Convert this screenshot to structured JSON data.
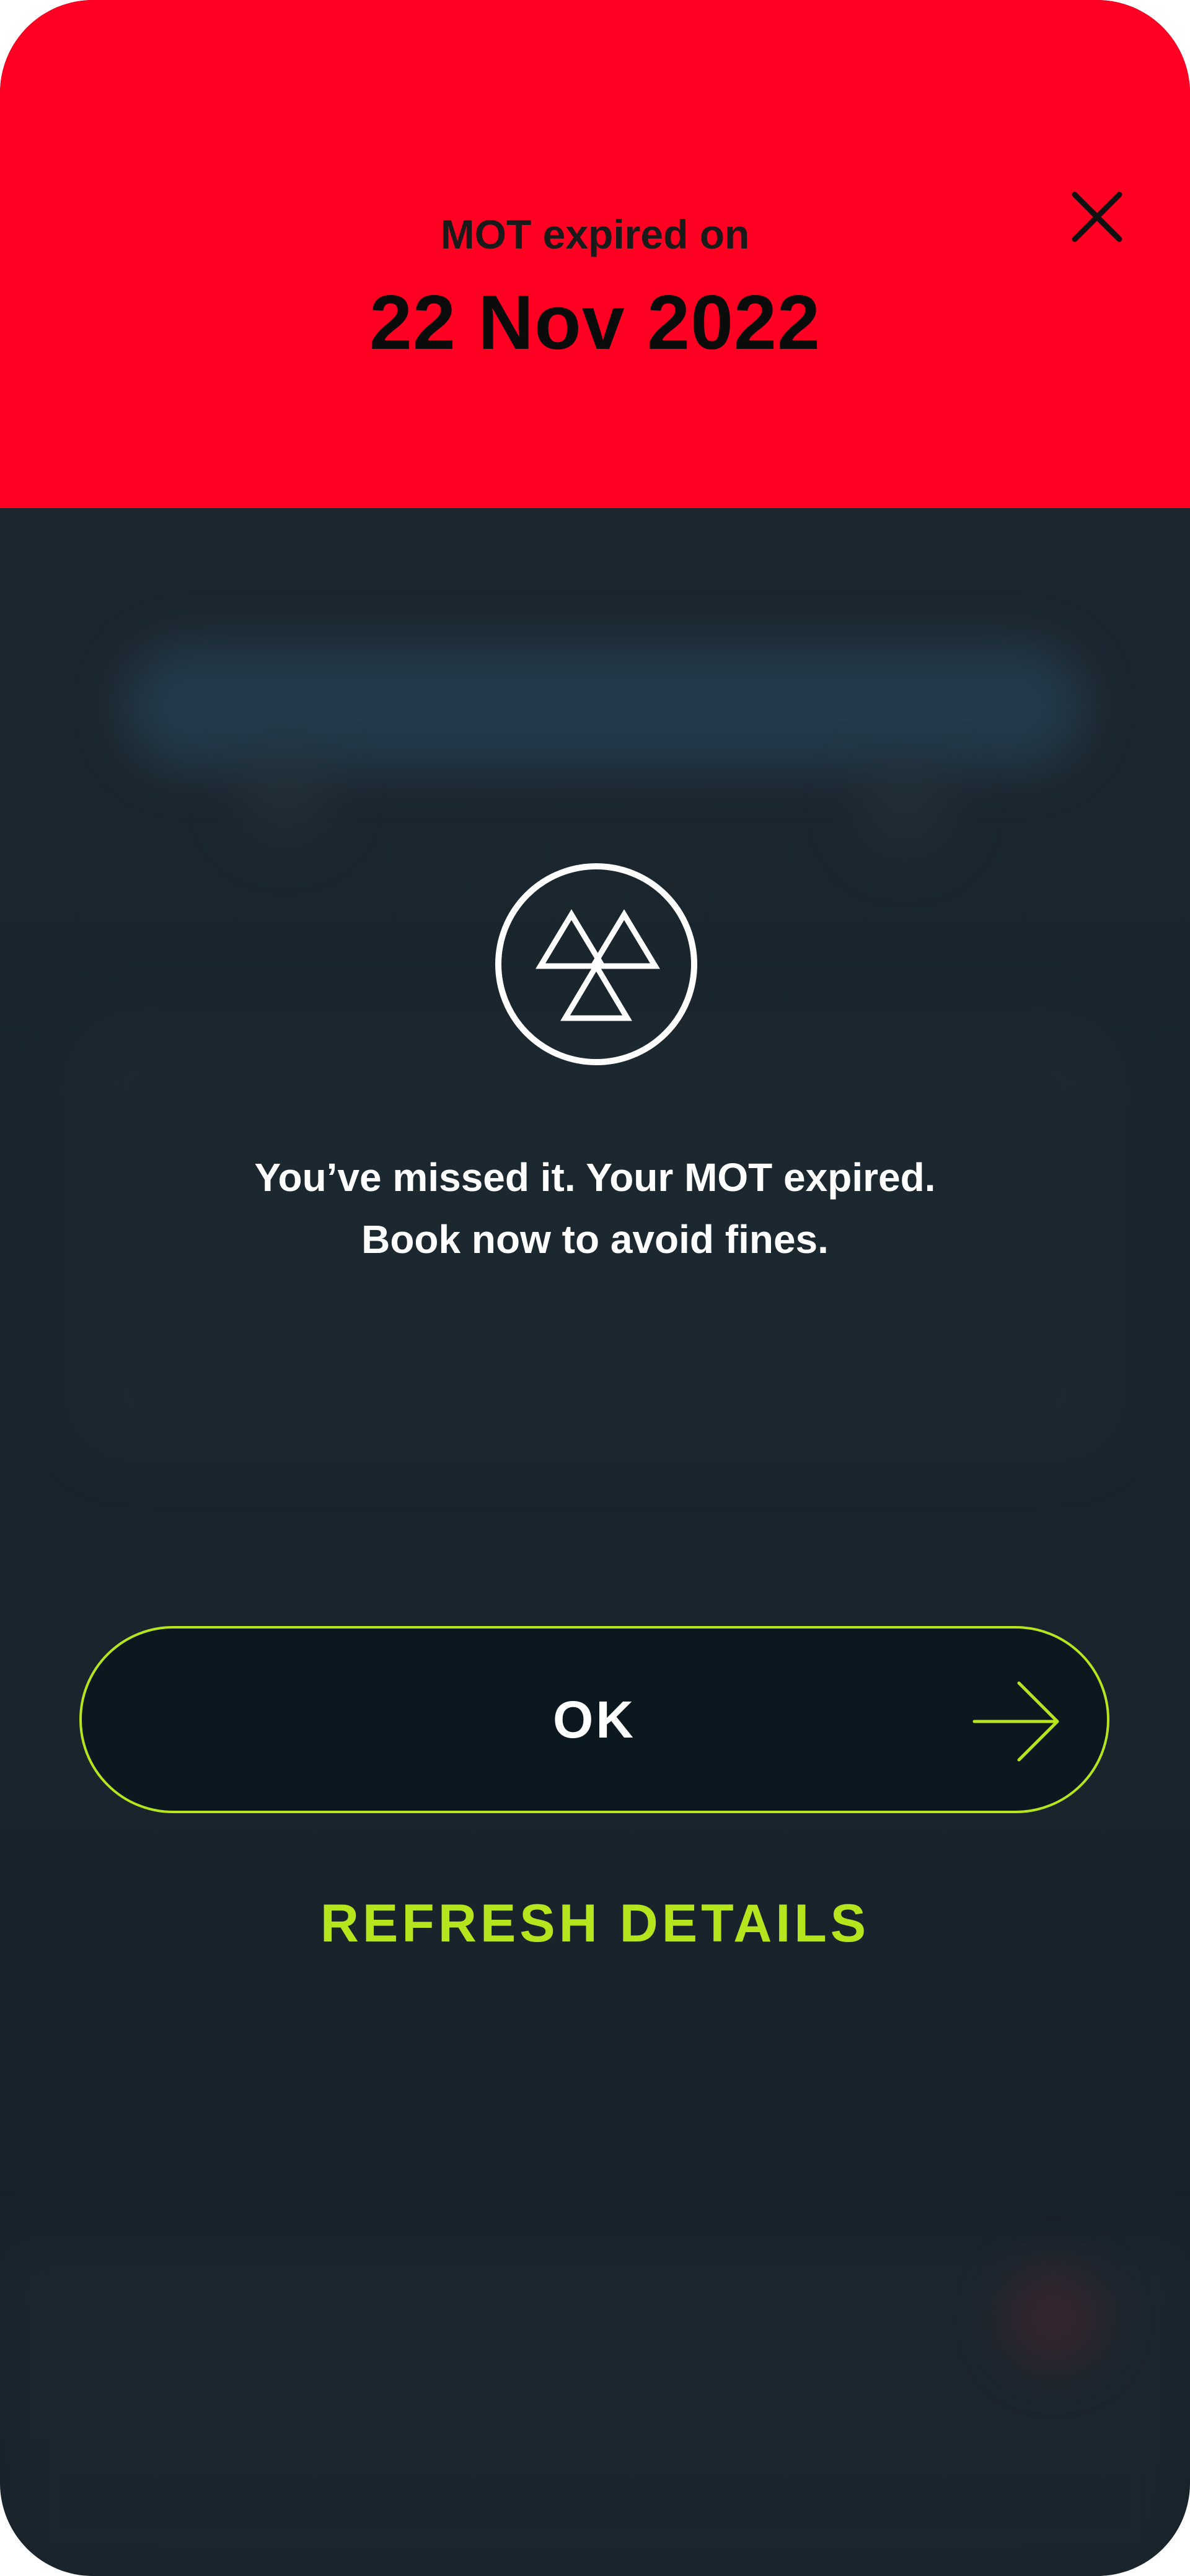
{
  "header": {
    "subtitle": "MOT expired on",
    "date": "22 Nov 2022",
    "close_icon": "close-icon"
  },
  "content": {
    "icon": "mot-triangles-icon",
    "message_line1": "You’ve missed it. Your MOT expired.",
    "message_line2": "Book now to avoid fines."
  },
  "actions": {
    "ok_label": "OK",
    "ok_icon": "arrow-right-icon",
    "refresh_label": "REFRESH DETAILS"
  },
  "colors": {
    "header_red": "#ff0022",
    "accent_lime": "#b5e51d",
    "background_dark": "#1a252d"
  }
}
